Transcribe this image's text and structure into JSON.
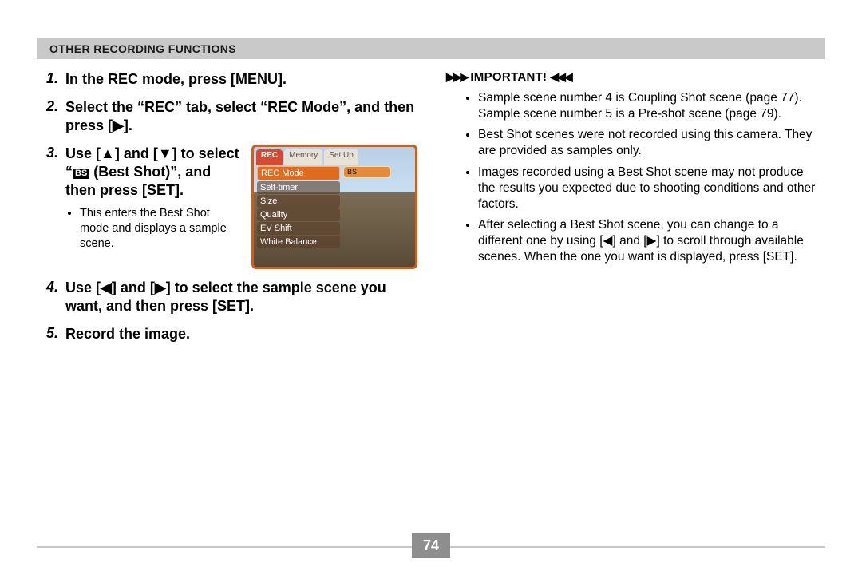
{
  "header": {
    "title": "Other Recording Functions"
  },
  "steps": {
    "s1": {
      "num": "1.",
      "title": "In the REC mode, press [MENU]."
    },
    "s2": {
      "num": "2.",
      "title": "Select the “REC” tab, select “REC Mode”, and then press [▶]."
    },
    "s3": {
      "num": "3.",
      "title_pre": "Use [▲] and [▼] to select “",
      "chip": "BS",
      "title_post": " (Best Shot)”, and then press [SET].",
      "note": "This enters the Best Shot mode and displays a sample scene."
    },
    "s4": {
      "num": "4.",
      "title": "Use [◀] and [▶] to select the sample scene you want, and then press [SET]."
    },
    "s5": {
      "num": "5.",
      "title": "Record the image."
    }
  },
  "camera": {
    "tab1": "REC",
    "tab2": "Memory",
    "tab3": "Set Up",
    "m1": "REC Mode",
    "m2": "Self-timer",
    "m3": "Size",
    "m4": "Quality",
    "m5": "EV Shift",
    "m6": "White Balance",
    "val": "BS"
  },
  "important": {
    "label": "IMPORTANT!",
    "i1": "Sample scene number 4 is Coupling Shot scene (page 77). Sample scene number 5 is a Pre-shot scene (page 79).",
    "i2": "Best Shot scenes were not recorded using this camera. They are provided as samples only.",
    "i3": "Images recorded using a Best Shot scene may not produce the results you expected due to shooting conditions and other factors.",
    "i4": "After selecting a Best Shot scene, you can change to a different one by using [◀] and [▶] to scroll through available scenes. When the one you want is displayed, press [SET]."
  },
  "page_number": "74"
}
